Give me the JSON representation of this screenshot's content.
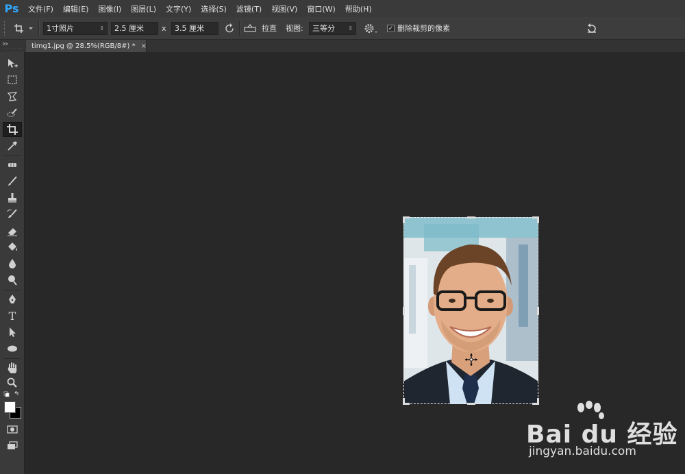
{
  "app": {
    "logo": "Ps"
  },
  "menu": [
    {
      "id": "file",
      "label": "文件(F)"
    },
    {
      "id": "edit",
      "label": "编辑(E)"
    },
    {
      "id": "image",
      "label": "图像(I)"
    },
    {
      "id": "layer",
      "label": "图层(L)"
    },
    {
      "id": "type",
      "label": "文字(Y)"
    },
    {
      "id": "select",
      "label": "选择(S)"
    },
    {
      "id": "filter",
      "label": "滤镜(T)"
    },
    {
      "id": "view",
      "label": "视图(V)"
    },
    {
      "id": "window",
      "label": "窗口(W)"
    },
    {
      "id": "help",
      "label": "帮助(H)"
    }
  ],
  "options": {
    "preset": "1寸照片",
    "width": "2.5 厘米",
    "times": "x",
    "height": "3.5 厘米",
    "straighten": "拉直",
    "view_label": "视图:",
    "view_value": "三等分",
    "delete_cropped_checked": true,
    "check_glyph": "✓",
    "delete_cropped_label": "删除裁剪的像素"
  },
  "tab": {
    "title": "timg1.jpg @ 28.5%(RGB/8#) *",
    "close": "×"
  },
  "watermark": {
    "brand": "Bai du 经验",
    "url": "jingyan.baidu.com"
  },
  "icons": {
    "crop": "crop-icon",
    "rotate": "rotate-icon",
    "level": "level-icon",
    "gear": "gear-icon",
    "reset": "reset-icon",
    "type_tool": "T"
  },
  "colors": {
    "accent": "#31a8ff",
    "foreground_swatch": "#ffffff",
    "background_swatch": "#000000"
  }
}
